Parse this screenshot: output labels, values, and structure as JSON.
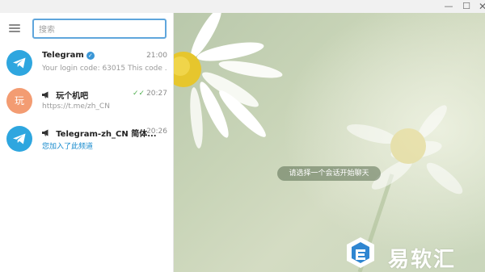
{
  "window": {
    "minimize_glyph": "—",
    "maximize_glyph": "☐",
    "close_glyph": "✕"
  },
  "search": {
    "placeholder": "搜索",
    "value": ""
  },
  "chats": [
    {
      "name": "Telegram",
      "verified": true,
      "time": "21:00",
      "preview": "Your login code: 63015  This code ...",
      "avatar_icon": "telegram-plane-icon",
      "avatar_color": "#2ea6df"
    },
    {
      "channel_icon": "megaphone-icon",
      "name": "玩个机吧",
      "time": "20:27",
      "read_ticks": "✓✓",
      "preview": "https://t.me/zh_CN",
      "avatar_text": "玩",
      "avatar_color": "#f39c72"
    },
    {
      "channel_icon": "megaphone-icon",
      "name": "Telegram-zh_CN 简体...",
      "time": "20:26",
      "preview": "您加入了此频道",
      "avatar_icon": "telegram-plane-icon",
      "avatar_color": "#2ea6df"
    }
  ],
  "main": {
    "empty_hint": "请选择一个会话开始聊天"
  },
  "watermark": {
    "text": "易软汇",
    "icon": "logo-icon"
  },
  "colors": {
    "accent": "#2ea6df",
    "link": "#168acd",
    "search_border": "#5fa6dc",
    "read_tick": "#4fae4e"
  }
}
